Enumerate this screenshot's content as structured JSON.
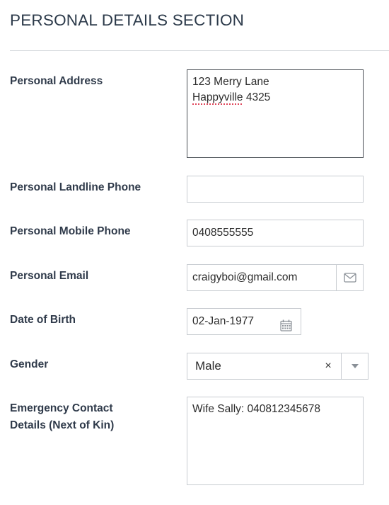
{
  "section": {
    "title": "PERSONAL DETAILS SECTION"
  },
  "fields": {
    "address": {
      "label": "Personal Address",
      "line1": "123 Merry Lane",
      "line2_word": "Happyville",
      "line2_rest": " 4325"
    },
    "landline": {
      "label": "Personal Landline Phone",
      "value": ""
    },
    "mobile": {
      "label": "Personal Mobile Phone",
      "value": "0408555555"
    },
    "email": {
      "label": "Personal Email",
      "value": "craigyboi@gmail.com",
      "icon": "envelope-icon"
    },
    "dob": {
      "label": "Date of Birth",
      "value": "02-Jan-1977",
      "icon": "calendar-icon"
    },
    "gender": {
      "label": "Gender",
      "value": "Male",
      "clear": "×",
      "icon": "chevron-down-icon"
    },
    "emergency": {
      "label_line1": "Emergency Contact",
      "label_line2": "Details (Next of Kin)",
      "value": "Wife Sally: 040812345678"
    }
  }
}
